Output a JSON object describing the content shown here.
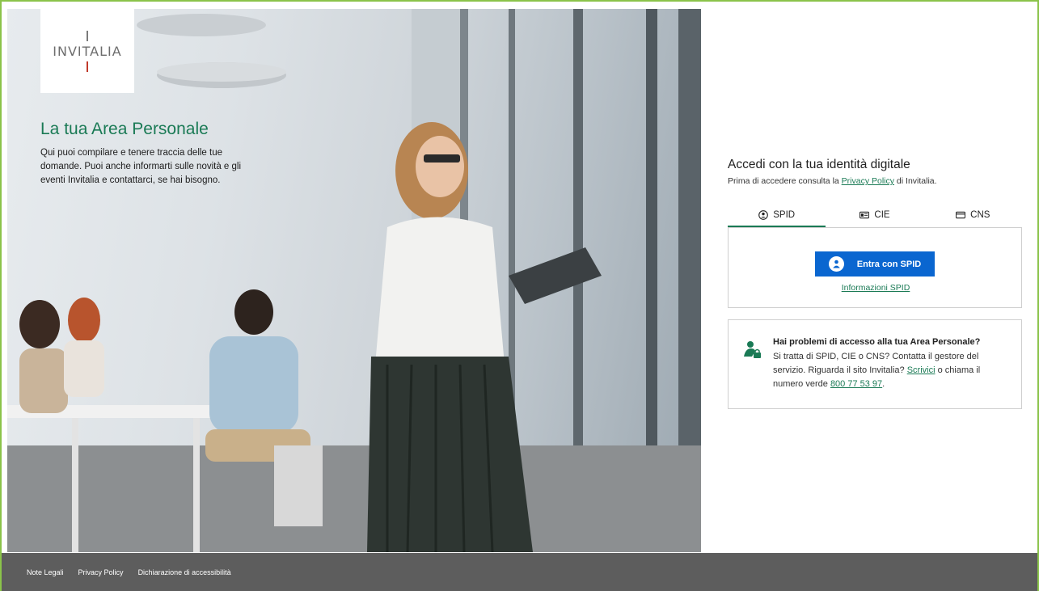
{
  "brand": {
    "logo_text": "INVITALIA",
    "accent_color": "#1a7a55",
    "logo_red": "#c0392b"
  },
  "hero": {
    "title": "La tua Area Personale",
    "description": "Qui puoi compilare e tenere traccia delle tue domande. Puoi anche informarti sulle novità e gli eventi Invitalia e contattarci, se hai bisogno."
  },
  "login": {
    "title": "Accedi con la tua identità digitale",
    "subtitle_before": "Prima di accedere consulta la ",
    "privacy_link": "Privacy Policy",
    "subtitle_after": " di Invitalia.",
    "tabs": [
      {
        "label": "SPID",
        "icon": "user-circle-icon",
        "active": true
      },
      {
        "label": "CIE",
        "icon": "id-card-icon",
        "active": false
      },
      {
        "label": "CNS",
        "icon": "card-icon",
        "active": false
      }
    ],
    "spid_button_label": "Entra con SPID",
    "spid_button_color": "#0a66d0",
    "spid_info_link": "Informazioni SPID"
  },
  "help": {
    "title": "Hai problemi di accesso alla tua Area Personale?",
    "body_1": "Si tratta di SPID, CIE o CNS? Contatta il gestore del servizio. Riguarda il sito Invitalia? ",
    "write_link": "Scrivici",
    "body_2": " o chiama il numero verde ",
    "phone_link": "800 77 53 97",
    "body_3": ".",
    "icon": "user-lock-icon"
  },
  "footer": {
    "links": [
      "Note Legali",
      "Privacy Policy",
      "Dichiarazione di accessibilità"
    ],
    "background": "#5d5d5d"
  }
}
